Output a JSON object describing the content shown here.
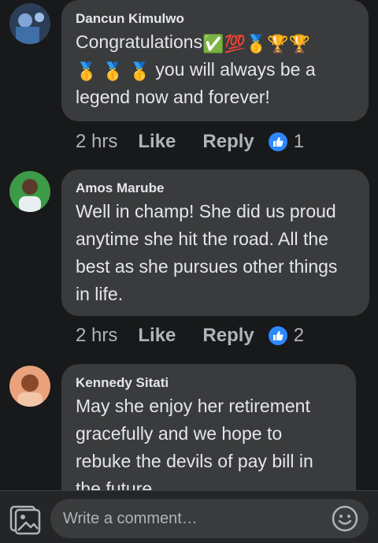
{
  "comments": [
    {
      "author": "Dancun Kimulwo",
      "text_start": "Congratulations",
      "emojis_line1": [
        "✅",
        "💯",
        "🥇",
        "🏆",
        "🏆"
      ],
      "emojis_line2": [
        "🥇",
        "🥇",
        "🥇"
      ],
      "text_line2": "you will always be a",
      "text_line3": "legend now and forever!",
      "time": "2 hrs",
      "like_label": "Like",
      "reply_label": "Reply",
      "reactions": "1",
      "avatar_color": "#3a5f8a"
    },
    {
      "author": "Amos Marube",
      "text": "Well in champ! She did us proud anytime she hit the road. All the best as she pursues other things in life.",
      "time": "2 hrs",
      "like_label": "Like",
      "reply_label": "Reply",
      "reactions": "2",
      "avatar_color": "#2e8b3a"
    },
    {
      "author": "Kennedy Sitati",
      "text": "May she enjoy her retirement gracefully and we hope to rebuke the devils of pay bill in the future",
      "avatar_color": "#d98a5a"
    }
  ],
  "composer": {
    "placeholder": "Write a comment…"
  },
  "icons": {
    "gallery": "photo-gallery-icon",
    "emoji": "smiley-icon",
    "reaction": "thumbs-up-icon"
  },
  "colors": {
    "background": "#18191a",
    "bubble": "#3a3b3c",
    "accent": "#2d88ff",
    "secondary_text": "#b0b3b8"
  }
}
